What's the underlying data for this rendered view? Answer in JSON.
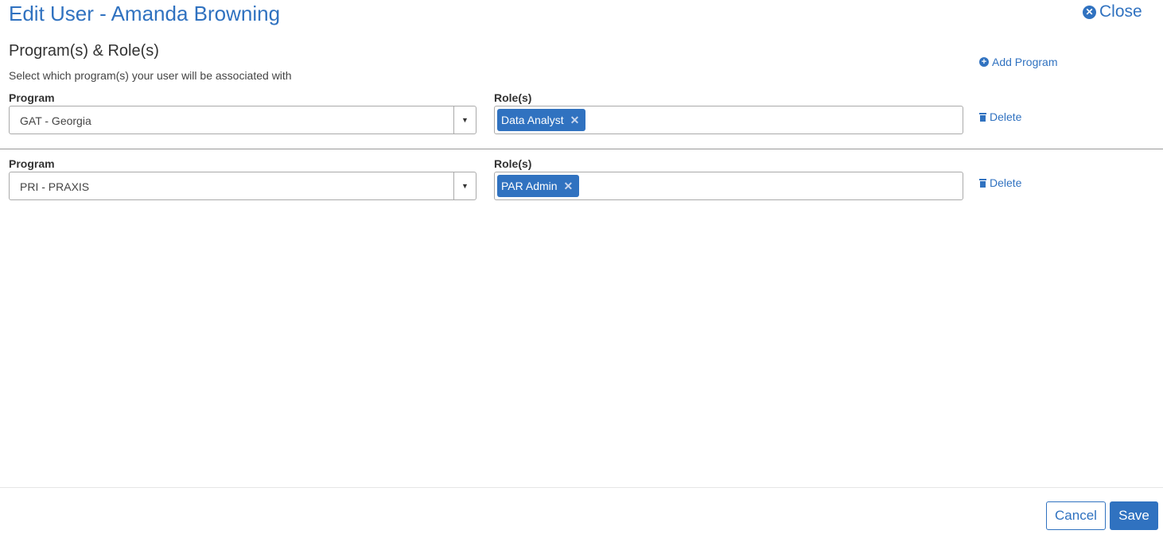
{
  "header": {
    "title": "Edit User - Amanda Browning",
    "close_label": "Close",
    "close_icon": "times-circle-icon"
  },
  "section": {
    "title": "Program(s) & Role(s)",
    "subtitle": "Select which program(s) your user will be associated with",
    "add_program_label": "Add Program",
    "add_program_icon": "plus-circle-icon"
  },
  "entries": [
    {
      "program_label": "Program",
      "program_value": "GAT - Georgia",
      "roles_label": "Role(s)",
      "roles": [
        "Data Analyst"
      ],
      "delete_label": "Delete"
    },
    {
      "program_label": "Program",
      "program_value": "PRI - PRAXIS",
      "roles_label": "Role(s)",
      "roles": [
        "PAR Admin"
      ],
      "delete_label": "Delete"
    }
  ],
  "footer": {
    "cancel_label": "Cancel",
    "save_label": "Save"
  },
  "colors": {
    "accent": "#3072c0"
  }
}
